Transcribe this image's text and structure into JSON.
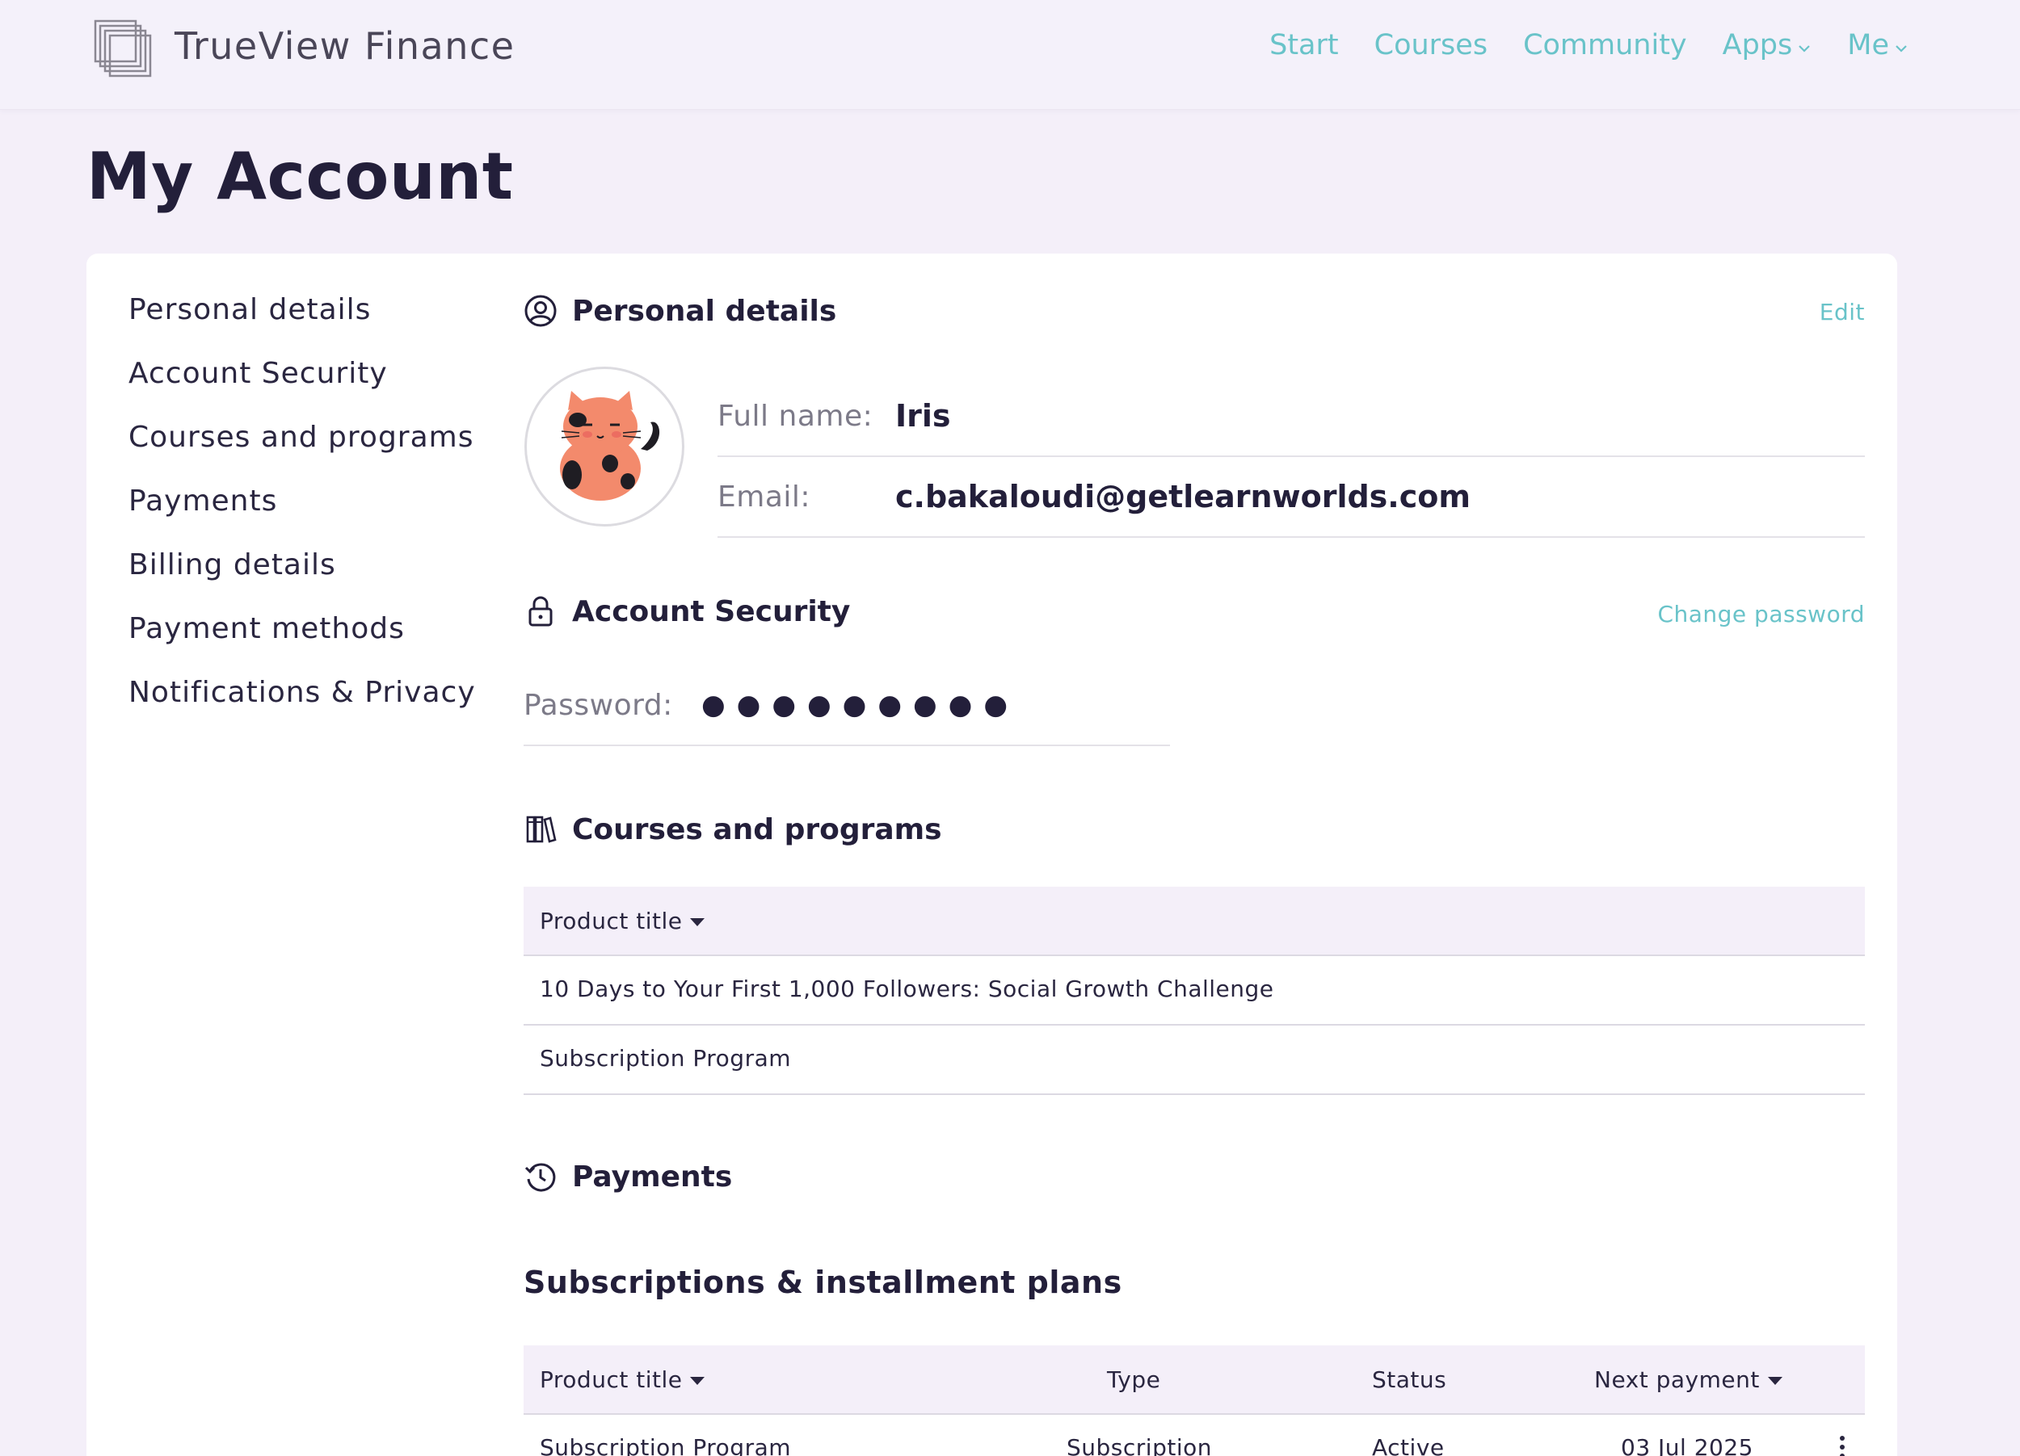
{
  "header": {
    "brand": "TrueView Finance",
    "nav": [
      {
        "label": "Start",
        "dropdown": false
      },
      {
        "label": "Courses",
        "dropdown": false
      },
      {
        "label": "Community",
        "dropdown": false
      },
      {
        "label": "Apps",
        "dropdown": true
      },
      {
        "label": "Me",
        "dropdown": true
      }
    ]
  },
  "page": {
    "title": "My Account"
  },
  "sidebar": {
    "items": [
      {
        "label": "Personal details"
      },
      {
        "label": "Account Security"
      },
      {
        "label": "Courses and programs"
      },
      {
        "label": "Payments"
      },
      {
        "label": "Billing details"
      },
      {
        "label": "Payment methods"
      },
      {
        "label": "Notifications & Privacy"
      }
    ]
  },
  "personal": {
    "title": "Personal details",
    "edit_label": "Edit",
    "fullname_label": "Full name:",
    "fullname_value": "Iris",
    "email_label": "Email:",
    "email_value": "c.bakaloudi@getlearnworlds.com"
  },
  "security": {
    "title": "Account Security",
    "change_password_label": "Change password",
    "password_label": "Password:",
    "password_mask": "●●●●●●●●●"
  },
  "courses": {
    "title": "Courses and programs",
    "header": "Product title",
    "rows": [
      "10 Days to Your First 1,000 Followers: Social Growth Challenge",
      "Subscription Program"
    ]
  },
  "payments": {
    "title": "Payments",
    "subtitle": "Subscriptions & installment plans",
    "columns": {
      "product": "Product title",
      "type": "Type",
      "status": "Status",
      "next": "Next payment"
    },
    "rows": [
      {
        "product": "Subscription Program",
        "type": "Subscription",
        "status": "Active",
        "next": "03 Jul 2025"
      }
    ]
  },
  "colors": {
    "accent": "#69c3c9",
    "background": "#f4eff9",
    "text": "#231f3a"
  }
}
